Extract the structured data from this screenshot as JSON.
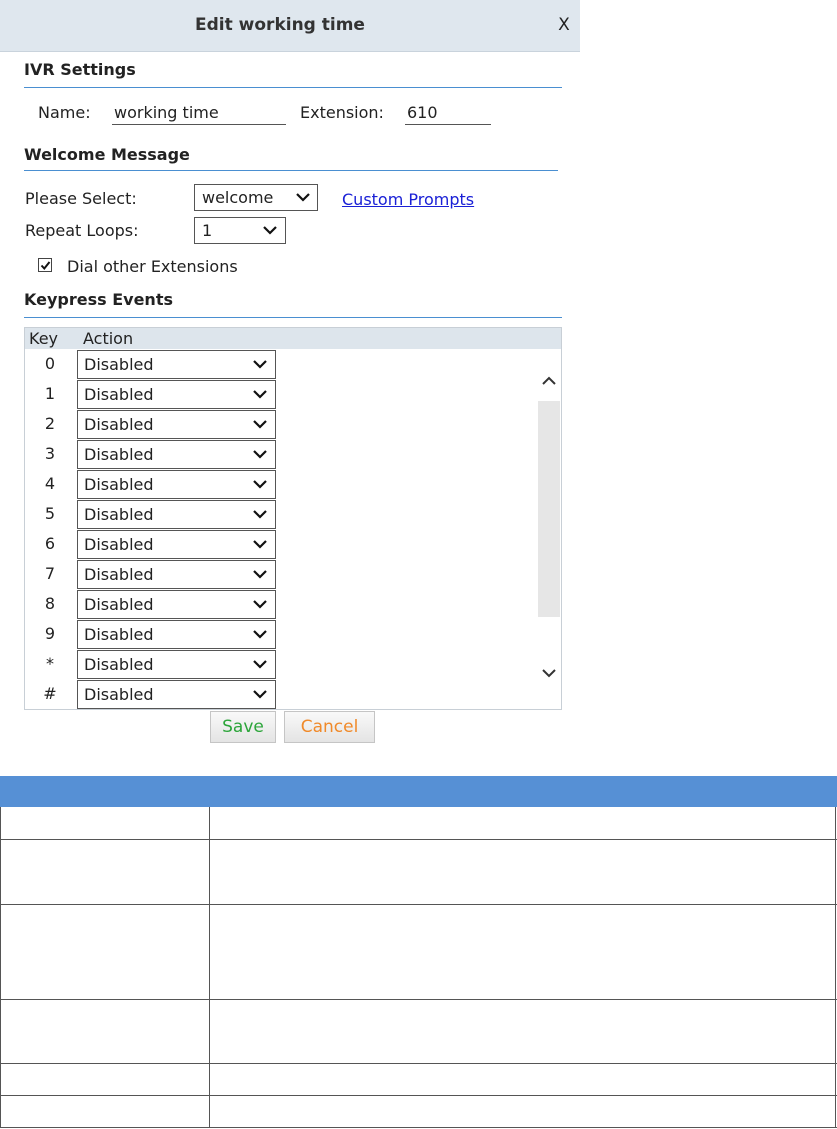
{
  "dialog": {
    "title": "Edit working time",
    "close_label": "X"
  },
  "ivr_settings": {
    "section_title": "IVR Settings",
    "name_label": "Name:",
    "name_value": "working time",
    "extension_label": "Extension:",
    "extension_value": "610"
  },
  "welcome_message": {
    "section_title": "Welcome Message",
    "please_select_label": "Please Select:",
    "please_select_value": "welcome",
    "custom_prompts_link": "Custom Prompts",
    "repeat_loops_label": "Repeat Loops:",
    "repeat_loops_value": "1",
    "dial_other_extensions_label": "Dial other Extensions",
    "dial_other_extensions_checked": true
  },
  "keypress_events": {
    "section_title": "Keypress Events",
    "headers": {
      "key": "Key",
      "action": "Action"
    },
    "rows": [
      {
        "key": "0",
        "action": "Disabled"
      },
      {
        "key": "1",
        "action": "Disabled"
      },
      {
        "key": "2",
        "action": "Disabled"
      },
      {
        "key": "3",
        "action": "Disabled"
      },
      {
        "key": "4",
        "action": "Disabled"
      },
      {
        "key": "5",
        "action": "Disabled"
      },
      {
        "key": "6",
        "action": "Disabled"
      },
      {
        "key": "7",
        "action": "Disabled"
      },
      {
        "key": "8",
        "action": "Disabled"
      },
      {
        "key": "9",
        "action": "Disabled"
      },
      {
        "key": "*",
        "action": "Disabled"
      },
      {
        "key": "#",
        "action": "Disabled"
      }
    ]
  },
  "buttons": {
    "save_label": "Save",
    "cancel_label": "Cancel"
  },
  "description_table": {
    "header_color": "#5690d5",
    "row_count": 6
  },
  "colors": {
    "accent_rule": "#4a8fd1",
    "link": "#1a20d6",
    "save_text": "#2ca53a",
    "cancel_text": "#f08a2a",
    "titlebar_bg": "#dfe7ee"
  }
}
